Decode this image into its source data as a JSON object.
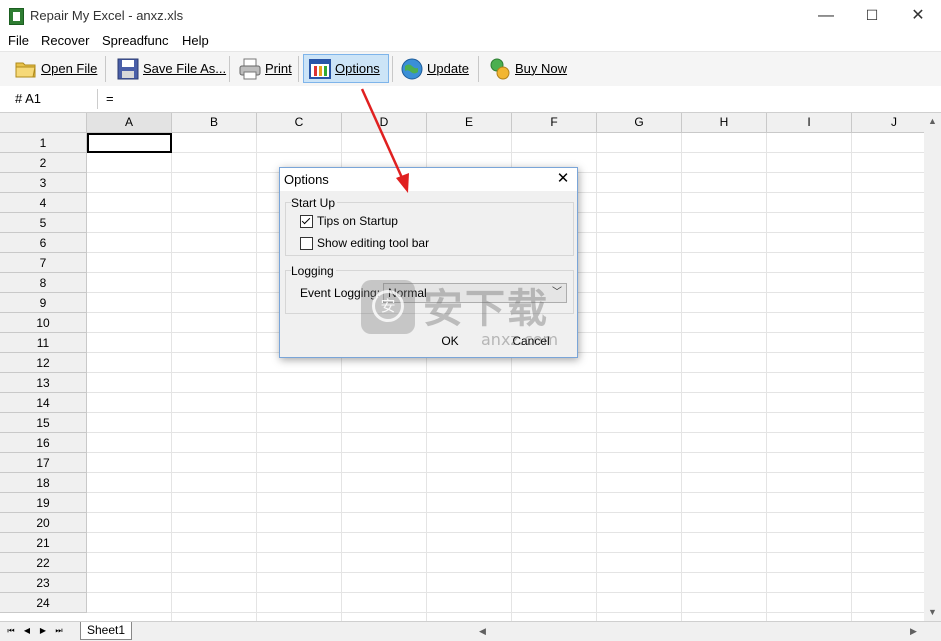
{
  "window": {
    "title": "Repair My Excel - anxz.xls",
    "minimize": "—",
    "maximize": "☐",
    "close": "✕"
  },
  "menu": [
    "File",
    "Recover",
    "Spreadfunc",
    "Help"
  ],
  "toolbar": {
    "open": "Open File",
    "save": "Save File As...",
    "print": "Print",
    "options": "Options",
    "update": "Update",
    "buy": "Buy Now"
  },
  "formula": {
    "cell_ref": "#  A1",
    "value": "="
  },
  "columns": [
    "A",
    "B",
    "C",
    "D",
    "E",
    "F",
    "G",
    "H",
    "I",
    "J"
  ],
  "rows": [
    "1",
    "2",
    "3",
    "4",
    "5",
    "6",
    "7",
    "8",
    "9",
    "10",
    "11",
    "12",
    "13",
    "14",
    "15",
    "16",
    "17",
    "18",
    "19",
    "20",
    "21",
    "22",
    "23",
    "24"
  ],
  "sheet_tab": "Sheet1",
  "dialog": {
    "title": "Options",
    "close": "✕",
    "startup_group": "Start Up",
    "tips_on_startup": {
      "label": "Tips on Startup",
      "checked": true
    },
    "show_editing_toolbar": {
      "label": "Show editing tool bar",
      "checked": false
    },
    "logging_group": "Logging",
    "event_logging_label": "Event Logging:",
    "event_logging_value": "Normal",
    "ok": "OK",
    "cancel": "Cancel"
  },
  "watermark": {
    "text_cn": "安下载",
    "text_en": "anxz.com",
    "badge": "安"
  },
  "colors": {
    "accent": "#cce4f7",
    "dialog_border": "#7aa5d8",
    "arrow": "#e02020"
  }
}
